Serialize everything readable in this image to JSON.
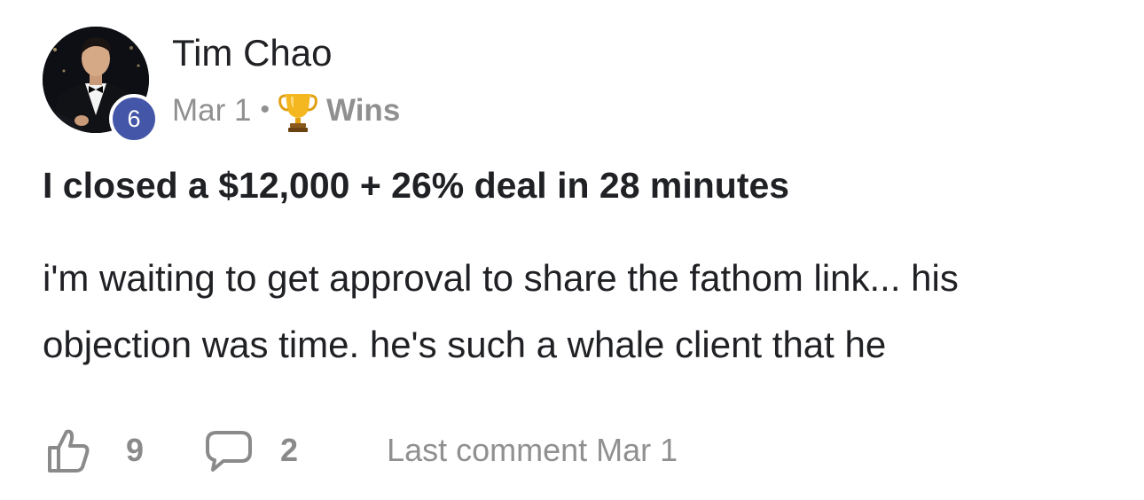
{
  "author": {
    "name": "Tim Chao",
    "level": "6"
  },
  "meta": {
    "date": "Mar 1",
    "separator": "•",
    "category": "Wins",
    "category_icon": "trophy-icon"
  },
  "post": {
    "title": "I closed a $12,000 + 26% deal in 28 minutes",
    "body": "i'm waiting to get approval to share the fathom link... his objection was time. he's such a whale client that he"
  },
  "actions": {
    "like_icon": "thumbs-up-icon",
    "like_count": "9",
    "comment_icon": "comment-bubble-icon",
    "comment_count": "2",
    "last_comment": "Last comment Mar 1"
  },
  "colors": {
    "level_badge": "#4456a8",
    "muted_text": "#909090",
    "primary_text": "#202124"
  }
}
